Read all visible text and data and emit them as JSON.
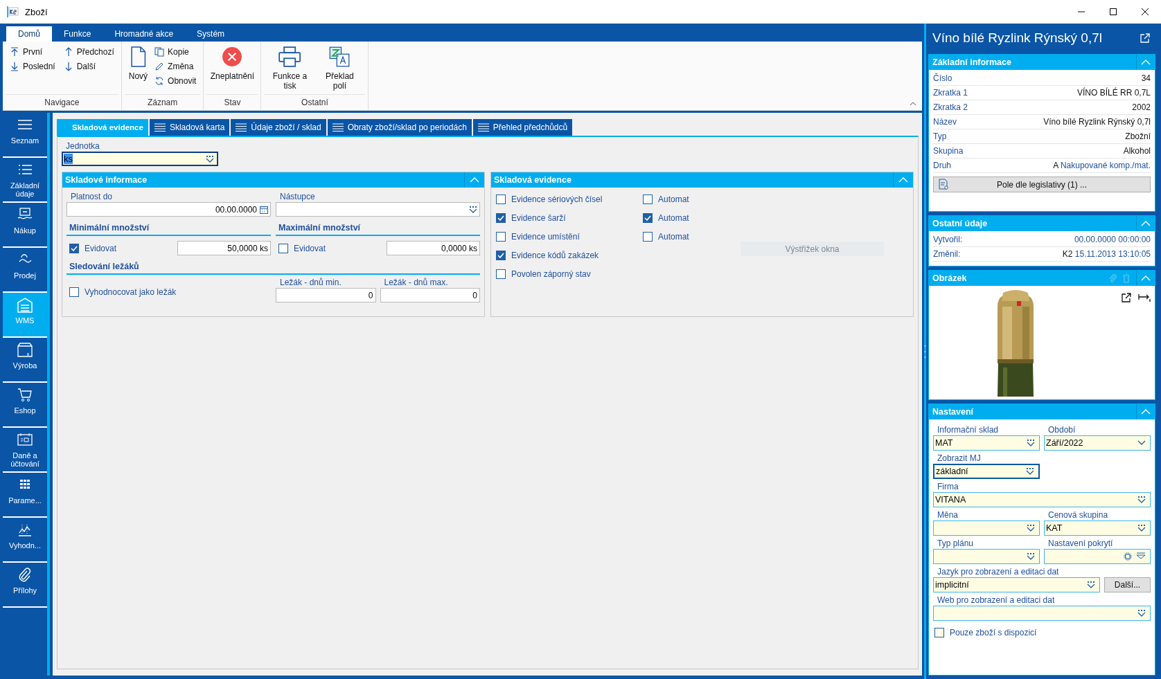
{
  "window": {
    "title": "Zboží"
  },
  "ribbon": {
    "tabs": [
      {
        "label": "Domů",
        "selected": true
      },
      {
        "label": "Funkce",
        "selected": false
      },
      {
        "label": "Hromadné akce",
        "selected": false
      },
      {
        "label": "Systém",
        "selected": false
      }
    ],
    "groups": [
      {
        "label": "Navigace",
        "buttons": [
          {
            "label": "První",
            "kind": "small"
          },
          {
            "label": "Poslední",
            "kind": "small"
          },
          {
            "label": "Předchozí",
            "kind": "small"
          },
          {
            "label": "Další",
            "kind": "small"
          }
        ]
      },
      {
        "label": "Záznam",
        "buttons": [
          {
            "label": "Nový",
            "kind": "large"
          },
          {
            "label": "Kopie",
            "kind": "small"
          },
          {
            "label": "Změna",
            "kind": "small"
          },
          {
            "label": "Obnovit",
            "kind": "small"
          }
        ]
      },
      {
        "label": "Stav",
        "buttons": [
          {
            "label": "Zneplatnění",
            "kind": "large"
          }
        ]
      },
      {
        "label": "Ostatní",
        "buttons": [
          {
            "label": "Funkce a tisk",
            "kind": "large"
          },
          {
            "label": "Překlad polí",
            "kind": "large"
          }
        ]
      }
    ]
  },
  "sidebar": {
    "items": [
      {
        "label": "Seznam",
        "selected": false
      },
      {
        "label": "Základní údaje",
        "selected": false
      },
      {
        "label": "Nákup",
        "selected": false
      },
      {
        "label": "Prodej",
        "selected": false
      },
      {
        "label": "WMS",
        "selected": true
      },
      {
        "label": "Výroba",
        "selected": false
      },
      {
        "label": "Eshop",
        "selected": false
      },
      {
        "label": "Daně a účtování",
        "selected": false
      },
      {
        "label": "Parame...",
        "selected": false
      },
      {
        "label": "Vyhodn...",
        "selected": false
      },
      {
        "label": "Přílohy",
        "selected": false
      }
    ]
  },
  "form": {
    "tabs": [
      {
        "label": "Skladová evidence",
        "selected": true
      },
      {
        "label": "Skladová karta",
        "selected": false
      },
      {
        "label": "Údaje zboží / sklad",
        "selected": false
      },
      {
        "label": "Obraty zboží/sklad po periodách",
        "selected": false
      },
      {
        "label": "Přehled předchůdců",
        "selected": false
      }
    ],
    "unit": {
      "label": "Jednotka",
      "value": "ks"
    },
    "storage_info": {
      "title": "Skladové informace",
      "valid_until": {
        "label": "Platnost do",
        "value": "00.00.0000"
      },
      "successor": {
        "label": "Nástupce"
      },
      "minimum": {
        "title": "Minimální množství",
        "checkbox": {
          "label": "Evidovat",
          "checked": true
        },
        "value": "50,0000",
        "unit": "ks"
      },
      "maximum": {
        "title": "Maximální množství",
        "checkbox": {
          "label": "Evidovat",
          "checked": false
        },
        "value": "0,0000",
        "unit": "ks"
      },
      "slow_moving": {
        "title": "Sledování ležáků",
        "checkbox": {
          "label": "Vyhodnocovat jako ležák",
          "checked": false
        },
        "min_days": {
          "label": "Ležák - dnů min.",
          "value": "0"
        },
        "max_days": {
          "label": "Ležák - dnů max.",
          "value": "0"
        }
      }
    },
    "stock_tracking": {
      "title": "Skladová evidence",
      "rows": [
        {
          "label": "Evidence sériových čísel",
          "checked": false,
          "automat": {
            "label": "Automat",
            "checked": false
          }
        },
        {
          "label": "Evidence šarží",
          "checked": true,
          "automat": {
            "label": "Automat",
            "checked": true
          }
        },
        {
          "label": "Evidence umístění",
          "checked": false,
          "automat": {
            "label": "Automat",
            "checked": false
          }
        },
        {
          "label": "Evidence kódů zakázek",
          "checked": true
        },
        {
          "label": "Povolen záporný stav",
          "checked": false
        }
      ],
      "snip_button": "Výstřižek okna"
    }
  },
  "detail": {
    "title": "Víno bílé Ryzlink Rýnský 0,7l",
    "basic": {
      "title": "Základní informace",
      "rows": [
        {
          "label": "Číslo",
          "value": "34"
        },
        {
          "label": "Zkratka 1",
          "value": "VÍNO BÍLÉ RR 0,7L"
        },
        {
          "label": "Zkratka 2",
          "value": "2002"
        },
        {
          "label": "Název",
          "value": "Víno bílé Ryzlink Rýnský 0,7l"
        },
        {
          "label": "Typ",
          "value": "Zbožní"
        },
        {
          "label": "Skupina",
          "value": "Alkohol"
        },
        {
          "label": "Druh",
          "code": "A",
          "value": "Nakupované komp./mat."
        }
      ],
      "button": "Pole dle legislativy (1) ..."
    },
    "other": {
      "title": "Ostatní údaje",
      "rows": [
        {
          "label": "Vytvořil:",
          "value": "00.00.0000 00:00:00"
        },
        {
          "label": "Změnil:",
          "code": "K2",
          "value": "15.11.2013 13:10:05"
        }
      ]
    },
    "image": {
      "title": "Obrázek",
      "kind": "picture"
    },
    "settings": {
      "title": "Nastavení",
      "fields": [
        {
          "label": "Informační sklad",
          "value": "MAT",
          "kind": "lookup",
          "wide": false,
          "focused": false
        },
        {
          "label": "Období",
          "value": "Září/2022",
          "kind": "combo",
          "wide": false,
          "focused": false
        },
        {
          "label": "Zobrazit MJ",
          "value": "základní",
          "kind": "lookup",
          "wide": false,
          "focused": true
        },
        {
          "label": "Firma",
          "value": "VITANA",
          "kind": "lookup",
          "wide": true,
          "focused": false
        },
        {
          "label": "Měna",
          "kind": "lookup",
          "wide": false,
          "focused": false
        },
        {
          "label": "Cenová skupina",
          "value": "KAT",
          "kind": "lookup",
          "wide": false,
          "focused": false
        },
        {
          "label": "Typ plánu",
          "kind": "lookup",
          "wide": false,
          "focused": false
        },
        {
          "label": "Nastavení pokrytí",
          "kind": "gear",
          "wide": false,
          "focused": false
        },
        {
          "label": "Jazyk pro zobrazení a editaci dat",
          "value": "implicitní",
          "kind": "lookup-button",
          "button": "Další...",
          "wide": true,
          "focused": false
        },
        {
          "label": "Web pro zobrazení a editaci dat",
          "kind": "lookup",
          "wide": true,
          "focused": false
        }
      ],
      "checkbox": {
        "label": "Pouze zboží s dispozicí",
        "checked": false
      }
    }
  }
}
